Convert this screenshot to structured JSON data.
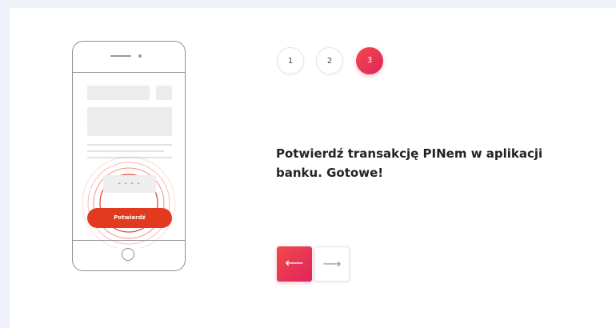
{
  "steps": {
    "items": [
      {
        "label": "1"
      },
      {
        "label": "2"
      },
      {
        "label": "3"
      }
    ],
    "active_index": 3
  },
  "phone": {
    "pin_mask": "----",
    "confirm_label": "Potwierdź"
  },
  "message": "Potwierdź transakcję PINem w aplikacji banku. Gotowe!",
  "navigation": {
    "prev_icon": "arrow-left-icon",
    "prev_symbol": "⟵",
    "next_icon": "arrow-right-icon",
    "next_symbol": "⟶"
  },
  "colors": {
    "accent_start": "#f04a4a",
    "accent_end": "#e0245e",
    "phone_button": "#e23a1e",
    "ring": "#e8332a",
    "page_background": "#eef0fa"
  }
}
